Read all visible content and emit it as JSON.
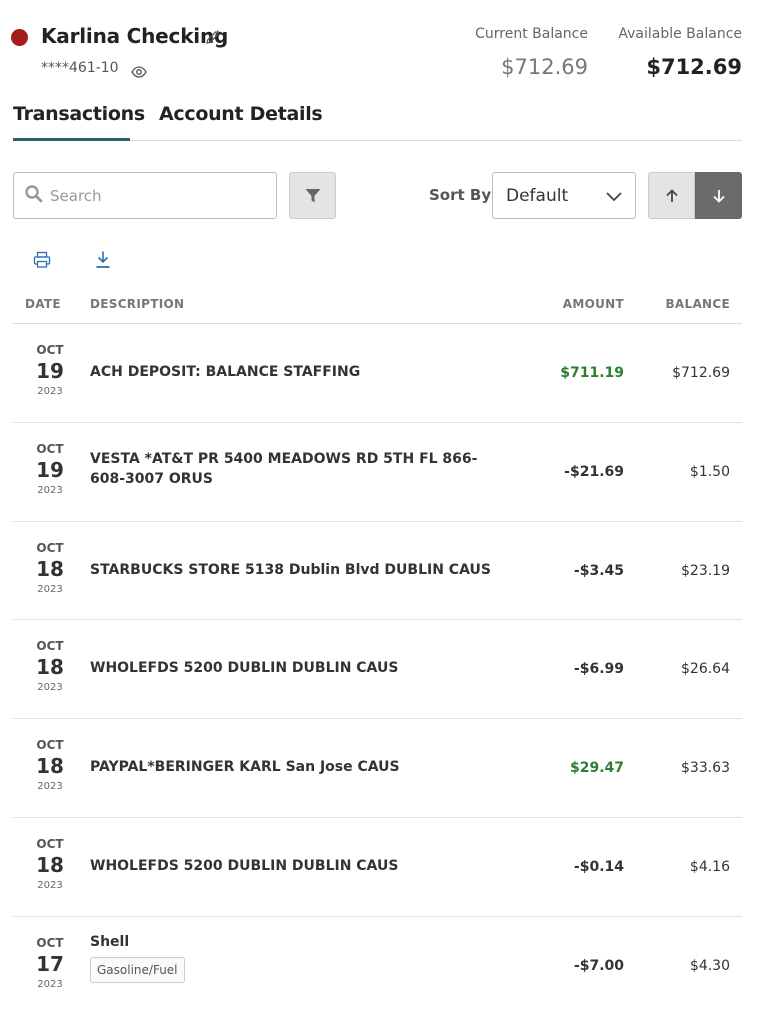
{
  "account": {
    "name": "Karlina Checking",
    "number": "****461-10",
    "dot_color": "#a71b1b"
  },
  "balances": {
    "current_label": "Current Balance",
    "current_value": "$712.69",
    "available_label": "Available Balance",
    "available_value": "$712.69"
  },
  "tabs": [
    {
      "label": "Transactions",
      "active": true
    },
    {
      "label": "Account Details",
      "active": false
    }
  ],
  "search": {
    "placeholder": "Search",
    "value": ""
  },
  "sort": {
    "label": "Sort By:",
    "value": "Default",
    "direction": "descending"
  },
  "table": {
    "headers": {
      "date": "DATE",
      "description": "DESCRIPTION",
      "amount": "AMOUNT",
      "balance": "BALANCE"
    },
    "rows": [
      {
        "month": "OCT",
        "day": "19",
        "year": "2023",
        "description": "ACH DEPOSIT: BALANCE STAFFING",
        "amount": "$711.19",
        "credit": true,
        "balance": "$712.69"
      },
      {
        "month": "OCT",
        "day": "19",
        "year": "2023",
        "description": "VESTA *AT&T PR 5400 MEADOWS RD 5TH FL 866-608-3007 ORUS",
        "amount": "-$21.69",
        "credit": false,
        "balance": "$1.50"
      },
      {
        "month": "OCT",
        "day": "18",
        "year": "2023",
        "description": "STARBUCKS STORE 5138 Dublin Blvd DUBLIN CAUS",
        "amount": "-$3.45",
        "credit": false,
        "balance": "$23.19"
      },
      {
        "month": "OCT",
        "day": "18",
        "year": "2023",
        "description": "WHOLEFDS 5200 DUBLIN DUBLIN CAUS",
        "amount": "-$6.99",
        "credit": false,
        "balance": "$26.64"
      },
      {
        "month": "OCT",
        "day": "18",
        "year": "2023",
        "description": "PAYPAL*BERINGER KARL San Jose CAUS",
        "amount": "$29.47",
        "credit": true,
        "balance": "$33.63"
      },
      {
        "month": "OCT",
        "day": "18",
        "year": "2023",
        "description": "WHOLEFDS 5200 DUBLIN DUBLIN CAUS",
        "amount": "-$0.14",
        "credit": false,
        "balance": "$4.16"
      },
      {
        "month": "OCT",
        "day": "17",
        "year": "2023",
        "description": "Shell",
        "tag": "Gasoline/Fuel",
        "amount": "-$7.00",
        "credit": false,
        "balance": "$4.30"
      }
    ]
  },
  "colors": {
    "accent": "#2d5f6e",
    "credit": "#2e7d32",
    "icon_blue": "#2a6fb0"
  },
  "icons": [
    "edit-icon",
    "eye-icon",
    "search-icon",
    "filter-icon",
    "chevron-down-icon",
    "arrow-up-icon",
    "arrow-down-icon",
    "print-icon",
    "download-icon"
  ]
}
